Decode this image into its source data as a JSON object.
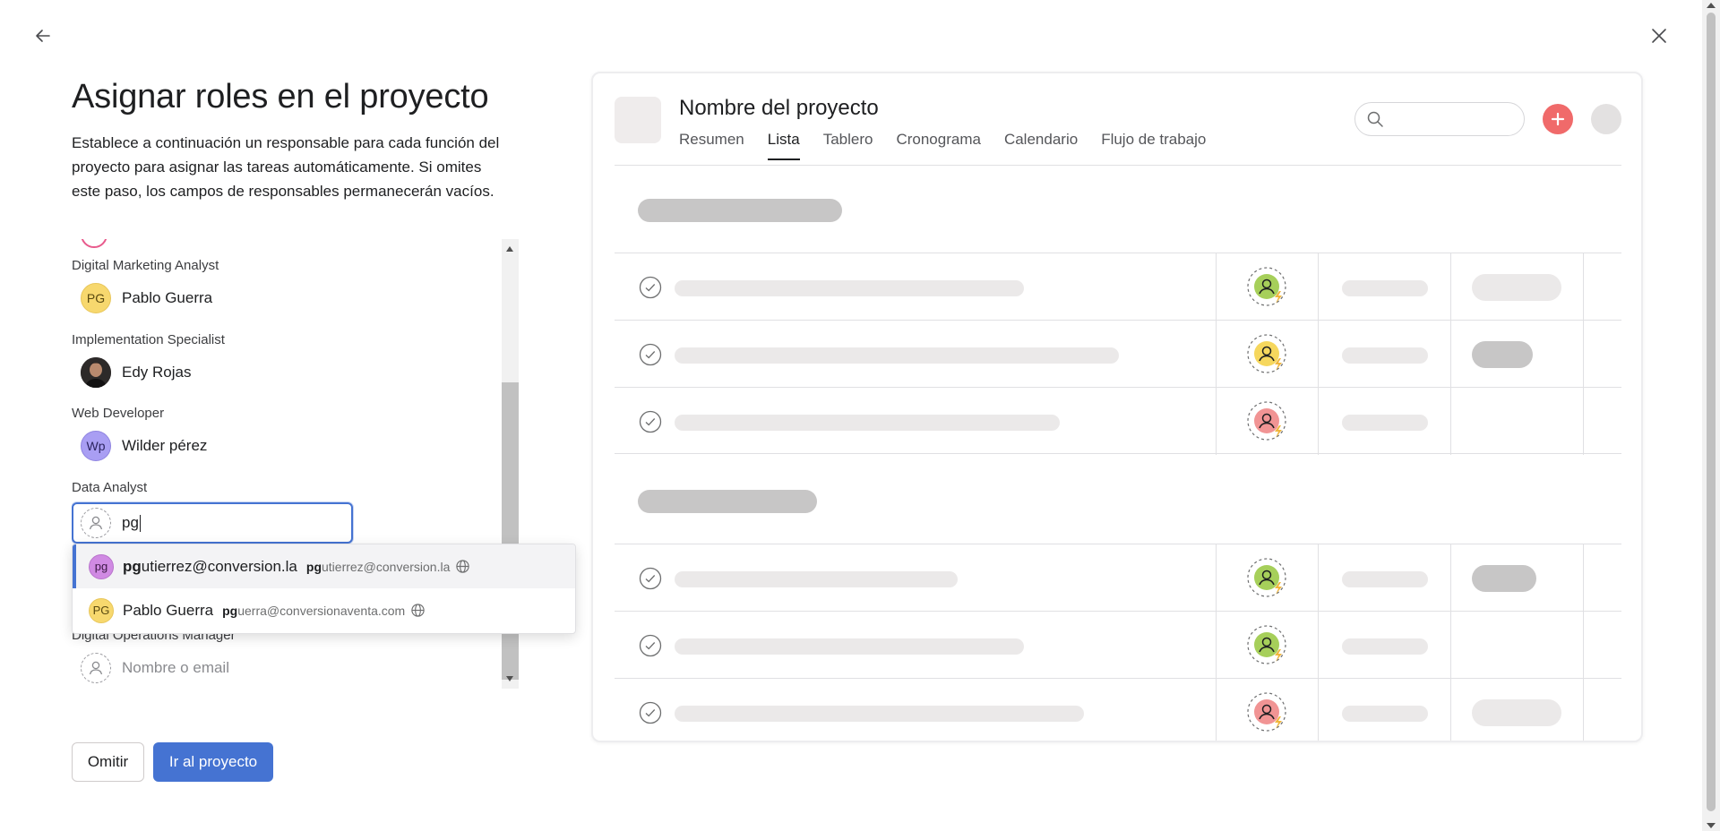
{
  "nav": {
    "back_icon": "arrow-left-icon",
    "close_icon": "close-icon"
  },
  "left": {
    "title": "Asignar roles en el proyecto",
    "description": "Establece a continuación un responsable para cada función del proyecto para asignar las tareas automáticamente. Si omites este paso, los campos de responsables permanecerán vacíos."
  },
  "roles": [
    {
      "label": "Digital Marketing Analyst",
      "initials": "PG",
      "name": "Pablo Guerra"
    },
    {
      "label": "Implementation Specialist",
      "initials": "",
      "name": "Edy Rojas"
    },
    {
      "label": "Web Developer",
      "initials": "Wp",
      "name": "Wilder pérez"
    },
    {
      "label": "Data Analyst",
      "input_value": "pg"
    },
    {
      "label": "Digital Operations Manager",
      "placeholder": "Nombre o email"
    }
  ],
  "dropdown": {
    "items": [
      {
        "initials": "pg",
        "match": "pg",
        "name_rest": "utierrez@conversion.la",
        "email_match": "pg",
        "email_rest": "utierrez@conversion.la"
      },
      {
        "initials": "PG",
        "name": "Pablo Guerra",
        "email_match": "pg",
        "email_rest": "uerra@conversionaventa.com"
      }
    ]
  },
  "buttons": {
    "skip": "Omitir",
    "go": "Ir al proyecto"
  },
  "preview": {
    "project_name": "Nombre del proyecto",
    "tabs": [
      "Resumen",
      "Lista",
      "Tablero",
      "Cronograma",
      "Calendario",
      "Flujo de trabajo"
    ],
    "active_tab": "Lista"
  },
  "colors": {
    "accent": "#4573d2",
    "plus": "#f06a6a",
    "assignee_green": "#a6cf5a",
    "assignee_yellow": "#f6d75d",
    "assignee_red": "#f19494"
  }
}
